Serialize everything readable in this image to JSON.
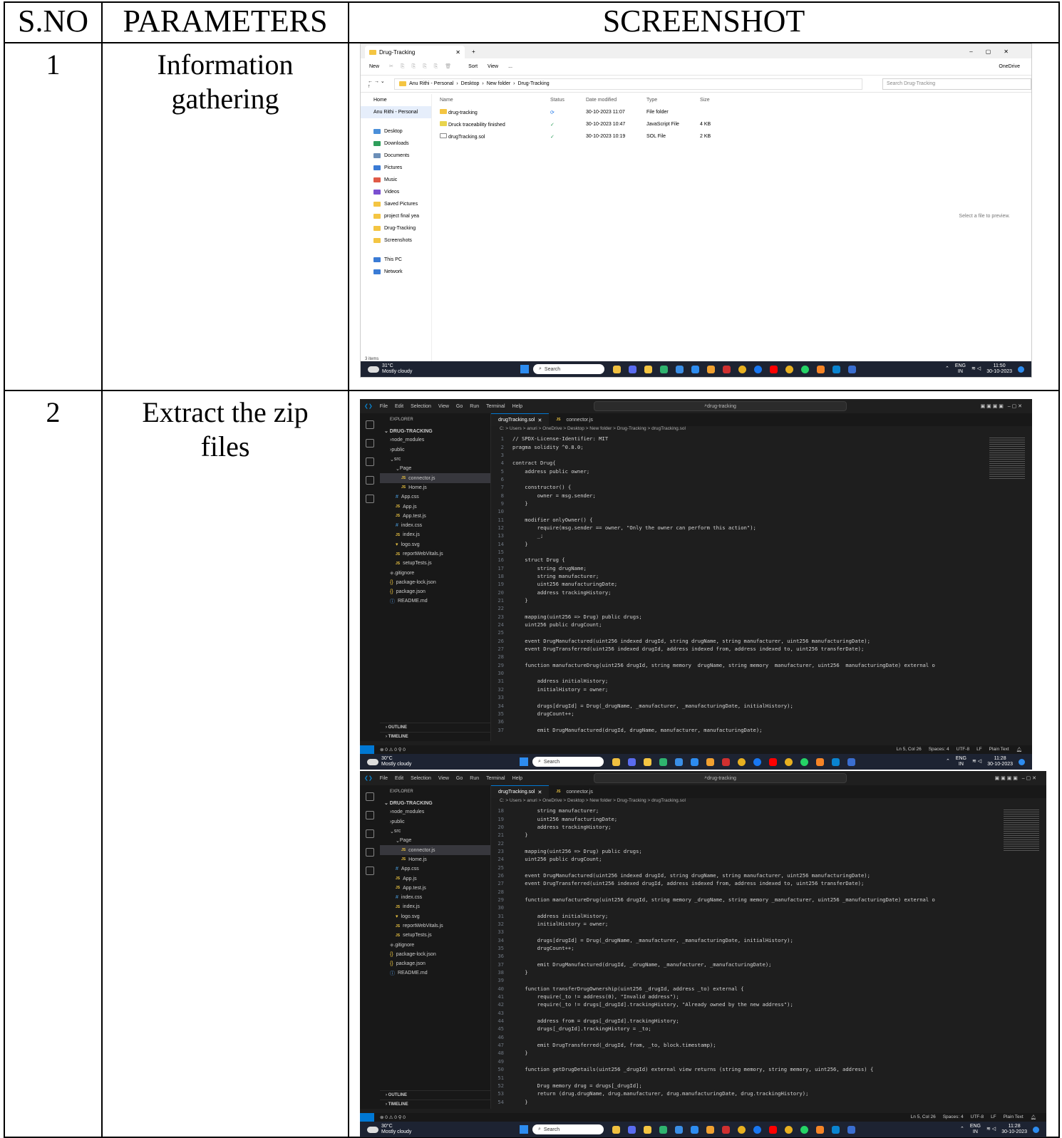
{
  "table": {
    "headers": [
      "S.NO",
      "PARAMETERS",
      "SCREENSHOT"
    ],
    "rows": [
      {
        "sno": "1",
        "param_line1": "Information",
        "param_line2": "gathering"
      },
      {
        "sno": "2",
        "param_line1": "Extract the zip",
        "param_line2": "files"
      }
    ]
  },
  "explorer": {
    "tab_title": "Drug-Tracking",
    "toolbar": [
      "New",
      "Sort",
      "View",
      "..."
    ],
    "onedrive": "OneDrive",
    "breadcrumb": [
      "Anu Rithi - Personal",
      "Desktop",
      "New folder",
      "Drug-Tracking"
    ],
    "search_placeholder": "Search Drug-Tracking",
    "sidebar": [
      "Home",
      "Anu Rithi - Personal",
      "Desktop",
      "Downloads",
      "Documents",
      "Pictures",
      "Music",
      "Videos",
      "Saved Pictures",
      "project final yea",
      "Drug-Tracking",
      "Screenshots",
      "This PC",
      "Network"
    ],
    "columns": [
      "Name",
      "Status",
      "Date modified",
      "Type",
      "Size"
    ],
    "files": [
      {
        "name": "drug-tracking",
        "date": "30-10-2023 11:07",
        "type": "File folder",
        "size": ""
      },
      {
        "name": "Druck traceability finished",
        "date": "30-10-2023 10:47",
        "type": "JavaScript File",
        "size": "4 KB"
      },
      {
        "name": "drugTracking.sol",
        "date": "30-10-2023 10:19",
        "type": "SOL File",
        "size": "2 KB"
      }
    ],
    "preview_msg": "Select a file to preview.",
    "status": "3 items"
  },
  "taskbar1": {
    "temp": "31°C",
    "weather": "Mostly cloudy",
    "search": "Search",
    "lang1": "ENG",
    "lang2": "IN",
    "time": "11:50",
    "date": "30-10-2023"
  },
  "taskbar2": {
    "temp": "30°C",
    "weather": "Mostly cloudy",
    "search": "Search",
    "lang1": "ENG",
    "lang2": "IN",
    "time": "11:28",
    "date": "30-10-2023"
  },
  "vscode": {
    "menu": [
      "File",
      "Edit",
      "Selection",
      "View",
      "Go",
      "Run",
      "Terminal",
      "Help"
    ],
    "search": "drug-tracking",
    "explorer_label": "EXPLORER",
    "project": "DRUG-TRACKING",
    "tree": [
      {
        "label": "node_modules",
        "kind": "dir",
        "indent": 1
      },
      {
        "label": "public",
        "kind": "dir",
        "indent": 1
      },
      {
        "label": "src",
        "kind": "dir",
        "indent": 1
      },
      {
        "label": "Page",
        "kind": "dir",
        "indent": 2
      },
      {
        "label": "connector.js",
        "kind": "js",
        "indent": 3
      },
      {
        "label": "Home.js",
        "kind": "js",
        "indent": 3
      },
      {
        "label": "App.css",
        "kind": "css",
        "indent": 2
      },
      {
        "label": "App.js",
        "kind": "js",
        "indent": 2
      },
      {
        "label": "App.test.js",
        "kind": "js",
        "indent": 2
      },
      {
        "label": "index.css",
        "kind": "css",
        "indent": 2
      },
      {
        "label": "index.js",
        "kind": "js",
        "indent": 2
      },
      {
        "label": "logo.svg",
        "kind": "svg",
        "indent": 2
      },
      {
        "label": "reportWebVitals.js",
        "kind": "js",
        "indent": 2
      },
      {
        "label": "setupTests.js",
        "kind": "js",
        "indent": 2
      },
      {
        "label": ".gitignore",
        "kind": "git",
        "indent": 1
      },
      {
        "label": "package-lock.json",
        "kind": "json",
        "indent": 1
      },
      {
        "label": "package.json",
        "kind": "json",
        "indent": 1
      },
      {
        "label": "README.md",
        "kind": "info",
        "indent": 1
      }
    ],
    "outline": "OUTLINE",
    "timeline": "TIMELINE",
    "tab_active": "drugTracking.sol",
    "tab_other": "connector.js",
    "breadcrumb": "C: > Users > anuri > OneDrive > Desktop > New folder > Drug-Tracking > drugTracking.sol",
    "status_left": "⊗ 0 ⚠ 0  ⚲ 0",
    "status_right": [
      "Ln 5, Col 26",
      "Spaces: 4",
      "UTF-8",
      "LF",
      "Plain Text"
    ],
    "code1": [
      {
        "n": "1",
        "t": "// SPDX-License-Identifier: MIT"
      },
      {
        "n": "2",
        "t": "pragma solidity ^0.8.0;"
      },
      {
        "n": "3",
        "t": ""
      },
      {
        "n": "4",
        "t": "contract Drug{"
      },
      {
        "n": "5",
        "t": "    address public owner;"
      },
      {
        "n": "6",
        "t": ""
      },
      {
        "n": "7",
        "t": "    constructor() {"
      },
      {
        "n": "8",
        "t": "        owner = msg.sender;"
      },
      {
        "n": "9",
        "t": "    }"
      },
      {
        "n": "10",
        "t": ""
      },
      {
        "n": "11",
        "t": "    modifier onlyOwner() {"
      },
      {
        "n": "12",
        "t": "        require(msg.sender == owner, \"Only the owner can perform this action\");"
      },
      {
        "n": "13",
        "t": "        _;"
      },
      {
        "n": "14",
        "t": "    }"
      },
      {
        "n": "15",
        "t": ""
      },
      {
        "n": "16",
        "t": "    struct Drug {"
      },
      {
        "n": "17",
        "t": "        string drugName;"
      },
      {
        "n": "18",
        "t": "        string manufacturer;"
      },
      {
        "n": "19",
        "t": "        uint256 manufacturingDate;"
      },
      {
        "n": "20",
        "t": "        address trackingHistory;"
      },
      {
        "n": "21",
        "t": "    }"
      },
      {
        "n": "22",
        "t": ""
      },
      {
        "n": "23",
        "t": "    mapping(uint256 => Drug) public drugs;"
      },
      {
        "n": "24",
        "t": "    uint256 public drugCount;"
      },
      {
        "n": "25",
        "t": ""
      },
      {
        "n": "26",
        "t": "    event DrugManufactured(uint256 indexed drugId, string drugName, string manufacturer, uint256 manufacturingDate);"
      },
      {
        "n": "27",
        "t": "    event DrugTransferred(uint256 indexed drugId, address indexed from, address indexed to, uint256 transferDate);"
      },
      {
        "n": "28",
        "t": ""
      },
      {
        "n": "29",
        "t": "    function manufactureDrug(uint256 drugId, string memory  drugName, string memory  manufacturer, uint256  manufacturingDate) external o"
      },
      {
        "n": "30",
        "t": ""
      },
      {
        "n": "31",
        "t": "        address initialHistory;"
      },
      {
        "n": "32",
        "t": "        initialHistory = owner;"
      },
      {
        "n": "33",
        "t": ""
      },
      {
        "n": "34",
        "t": "        drugs[drugId] = Drug(_drugName, _manufacturer, _manufacturingDate, initialHistory);"
      },
      {
        "n": "35",
        "t": "        drugCount++;"
      },
      {
        "n": "36",
        "t": ""
      },
      {
        "n": "37",
        "t": "        emit DrugManufactured(drugId, drugName, manufacturer, manufacturingDate);"
      }
    ],
    "code2": [
      {
        "n": "18",
        "t": "        string manufacturer;"
      },
      {
        "n": "19",
        "t": "        uint256 manufacturingDate;"
      },
      {
        "n": "20",
        "t": "        address trackingHistory;"
      },
      {
        "n": "21",
        "t": "    }"
      },
      {
        "n": "22",
        "t": ""
      },
      {
        "n": "23",
        "t": "    mapping(uint256 => Drug) public drugs;"
      },
      {
        "n": "24",
        "t": "    uint256 public drugCount;"
      },
      {
        "n": "25",
        "t": ""
      },
      {
        "n": "26",
        "t": "    event DrugManufactured(uint256 indexed drugId, string drugName, string manufacturer, uint256 manufacturingDate);"
      },
      {
        "n": "27",
        "t": "    event DrugTransferred(uint256 indexed drugId, address indexed from, address indexed to, uint256 transferDate);"
      },
      {
        "n": "28",
        "t": ""
      },
      {
        "n": "29",
        "t": "    function manufactureDrug(uint256 drugId, string memory _drugName, string memory _manufacturer, uint256 _manufacturingDate) external o"
      },
      {
        "n": "30",
        "t": ""
      },
      {
        "n": "31",
        "t": "        address initialHistory;"
      },
      {
        "n": "32",
        "t": "        initialHistory = owner;"
      },
      {
        "n": "33",
        "t": ""
      },
      {
        "n": "34",
        "t": "        drugs[drugId] = Drug(_drugName, _manufacturer, _manufacturingDate, initialHistory);"
      },
      {
        "n": "35",
        "t": "        drugCount++;"
      },
      {
        "n": "36",
        "t": ""
      },
      {
        "n": "37",
        "t": "        emit DrugManufactured(drugId, _drugName, _manufacturer, _manufacturingDate);"
      },
      {
        "n": "38",
        "t": "    }"
      },
      {
        "n": "39",
        "t": ""
      },
      {
        "n": "40",
        "t": "    function transferDrugOwnership(uint256 _drugId, address _to) external {"
      },
      {
        "n": "41",
        "t": "        require(_to != address(0), \"Invalid address\");"
      },
      {
        "n": "42",
        "t": "        require(_to != drugs[_drugId].trackingHistory, \"Already owned by the new address\");"
      },
      {
        "n": "43",
        "t": ""
      },
      {
        "n": "44",
        "t": "        address from = drugs[_drugId].trackingHistory;"
      },
      {
        "n": "45",
        "t": "        drugs[_drugId].trackingHistory = _to;"
      },
      {
        "n": "46",
        "t": ""
      },
      {
        "n": "47",
        "t": "        emit DrugTransferred(_drugId, from, _to, block.timestamp);"
      },
      {
        "n": "48",
        "t": "    }"
      },
      {
        "n": "49",
        "t": ""
      },
      {
        "n": "50",
        "t": "    function getDrugDetails(uint256 _drugId) external view returns (string memory, string memory, uint256, address) {"
      },
      {
        "n": "51",
        "t": ""
      },
      {
        "n": "52",
        "t": "        Drug memory drug = drugs[_drugId];"
      },
      {
        "n": "53",
        "t": "        return (drug.drugName, drug.manufacturer, drug.manufacturingDate, drug.trackingHistory);"
      },
      {
        "n": "54",
        "t": "    }"
      }
    ]
  }
}
